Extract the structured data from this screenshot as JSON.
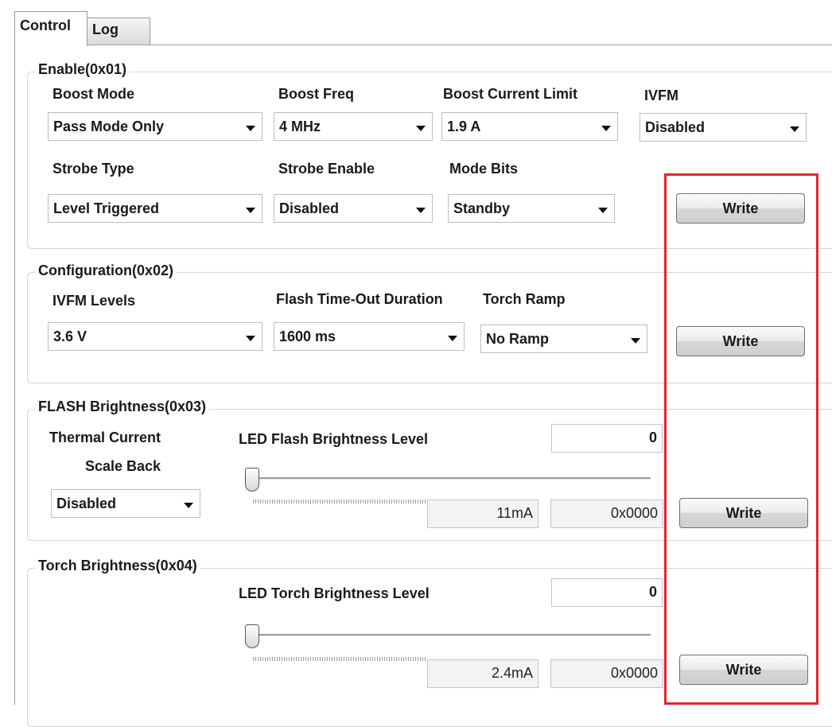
{
  "tabs": [
    {
      "label": "Control",
      "active": true
    },
    {
      "label": "Log",
      "active": false
    }
  ],
  "enable": {
    "title": "Enable(0x01)",
    "boost_mode": {
      "label": "Boost Mode",
      "value": "Pass Mode Only"
    },
    "boost_freq": {
      "label": "Boost Freq",
      "value": "4 MHz"
    },
    "boost_current_limit": {
      "label": "Boost Current Limit",
      "value": "1.9 A"
    },
    "ivfm": {
      "label": "IVFM",
      "value": "Disabled"
    },
    "strobe_type": {
      "label": "Strobe Type",
      "value": "Level Triggered"
    },
    "strobe_enable": {
      "label": "Strobe Enable",
      "value": "Disabled"
    },
    "mode_bits": {
      "label": "Mode Bits",
      "value": "Standby"
    },
    "write_label": "Write"
  },
  "configuration": {
    "title": "Configuration(0x02)",
    "ivfm_levels": {
      "label": "IVFM Levels",
      "value": "3.6 V"
    },
    "flash_timeout": {
      "label": "Flash Time-Out Duration",
      "value": "1600 ms"
    },
    "torch_ramp": {
      "label": "Torch Ramp",
      "value": "No Ramp"
    },
    "write_label": "Write"
  },
  "flash_brightness": {
    "title": "FLASH Brightness(0x03)",
    "thermal_label_1": "Thermal Current",
    "thermal_label_2": "Scale Back",
    "thermal_value": "Disabled",
    "level_label": "LED Flash Brightness Level",
    "level_value": "0",
    "slider_fraction": 0,
    "current": "11mA",
    "hex": "0x0000",
    "write_label": "Write"
  },
  "torch_brightness": {
    "title": "Torch Brightness(0x04)",
    "level_label": "LED Torch Brightness Level",
    "level_value": "0",
    "slider_fraction": 0,
    "current": "2.4mA",
    "hex": "0x0000",
    "write_label": "Write"
  },
  "colors": {
    "highlight": "#e0262e",
    "group_border": "#d4d4d4"
  }
}
